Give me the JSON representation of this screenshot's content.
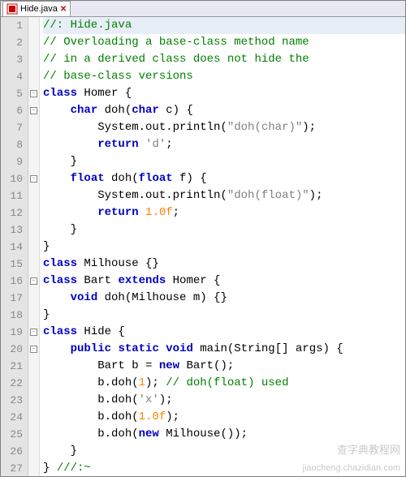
{
  "tab": {
    "filename": "Hide.java"
  },
  "code": {
    "lines": [
      {
        "n": 1,
        "fold": "",
        "seg": [
          [
            "c-comment",
            "//: Hide.java"
          ]
        ],
        "hl": true
      },
      {
        "n": 2,
        "fold": "",
        "seg": [
          [
            "c-comment",
            "// Overloading a base-class method name"
          ]
        ]
      },
      {
        "n": 3,
        "fold": "",
        "seg": [
          [
            "c-comment",
            "// in a derived class does not hide the"
          ]
        ]
      },
      {
        "n": 4,
        "fold": "",
        "seg": [
          [
            "c-comment",
            "// base-class versions"
          ]
        ]
      },
      {
        "n": 5,
        "fold": "box",
        "seg": [
          [
            "c-kw",
            "class"
          ],
          [
            "",
            " "
          ],
          [
            "c-id",
            "Homer"
          ],
          [
            "",
            " {"
          ]
        ]
      },
      {
        "n": 6,
        "fold": "box",
        "seg": [
          [
            "",
            "    "
          ],
          [
            "c-type",
            "char"
          ],
          [
            "",
            " doh("
          ],
          [
            "c-type",
            "char"
          ],
          [
            "",
            " c) {"
          ]
        ]
      },
      {
        "n": 7,
        "fold": "",
        "seg": [
          [
            "",
            "        System.out.println("
          ],
          [
            "c-str",
            "\"doh(char)\""
          ],
          [
            "",
            ");"
          ]
        ]
      },
      {
        "n": 8,
        "fold": "",
        "seg": [
          [
            "",
            "        "
          ],
          [
            "c-kw",
            "return"
          ],
          [
            "",
            " "
          ],
          [
            "c-char",
            "'d'"
          ],
          [
            "",
            ";"
          ]
        ]
      },
      {
        "n": 9,
        "fold": "",
        "seg": [
          [
            "",
            "    }"
          ]
        ]
      },
      {
        "n": 10,
        "fold": "box",
        "seg": [
          [
            "",
            "    "
          ],
          [
            "c-type",
            "float"
          ],
          [
            "",
            " doh("
          ],
          [
            "c-type",
            "float"
          ],
          [
            "",
            " f) {"
          ]
        ]
      },
      {
        "n": 11,
        "fold": "",
        "seg": [
          [
            "",
            "        System.out.println("
          ],
          [
            "c-str",
            "\"doh(float)\""
          ],
          [
            "",
            ");"
          ]
        ]
      },
      {
        "n": 12,
        "fold": "",
        "seg": [
          [
            "",
            "        "
          ],
          [
            "c-kw",
            "return"
          ],
          [
            "",
            " "
          ],
          [
            "c-num",
            "1.0f"
          ],
          [
            "",
            ";"
          ]
        ]
      },
      {
        "n": 13,
        "fold": "",
        "seg": [
          [
            "",
            "    }"
          ]
        ]
      },
      {
        "n": 14,
        "fold": "",
        "seg": [
          [
            "",
            "}"
          ]
        ]
      },
      {
        "n": 15,
        "fold": "",
        "seg": [
          [
            "c-kw",
            "class"
          ],
          [
            "",
            " Milhouse {}"
          ]
        ]
      },
      {
        "n": 16,
        "fold": "box",
        "seg": [
          [
            "c-kw",
            "class"
          ],
          [
            "",
            " Bart "
          ],
          [
            "c-kw",
            "extends"
          ],
          [
            "",
            " Homer {"
          ]
        ]
      },
      {
        "n": 17,
        "fold": "",
        "seg": [
          [
            "",
            "    "
          ],
          [
            "c-type",
            "void"
          ],
          [
            "",
            " doh(Milhouse m) {}"
          ]
        ]
      },
      {
        "n": 18,
        "fold": "",
        "seg": [
          [
            "",
            "}"
          ]
        ]
      },
      {
        "n": 19,
        "fold": "box",
        "seg": [
          [
            "c-kw",
            "class"
          ],
          [
            "",
            " Hide {"
          ]
        ]
      },
      {
        "n": 20,
        "fold": "box",
        "seg": [
          [
            "",
            "    "
          ],
          [
            "c-kw",
            "public"
          ],
          [
            "",
            " "
          ],
          [
            "c-kw",
            "static"
          ],
          [
            "",
            " "
          ],
          [
            "c-type",
            "void"
          ],
          [
            "",
            " main(String[] args) {"
          ]
        ]
      },
      {
        "n": 21,
        "fold": "",
        "seg": [
          [
            "",
            "        Bart b = "
          ],
          [
            "c-kw",
            "new"
          ],
          [
            "",
            " Bart();"
          ]
        ]
      },
      {
        "n": 22,
        "fold": "",
        "seg": [
          [
            "",
            "        b.doh("
          ],
          [
            "c-num",
            "1"
          ],
          [
            "",
            "); "
          ],
          [
            "c-comment",
            "// doh(float) used"
          ]
        ]
      },
      {
        "n": 23,
        "fold": "",
        "seg": [
          [
            "",
            "        b.doh("
          ],
          [
            "c-char",
            "'x'"
          ],
          [
            "",
            ");"
          ]
        ]
      },
      {
        "n": 24,
        "fold": "",
        "seg": [
          [
            "",
            "        b.doh("
          ],
          [
            "c-num",
            "1.0f"
          ],
          [
            "",
            ");"
          ]
        ]
      },
      {
        "n": 25,
        "fold": "",
        "seg": [
          [
            "",
            "        b.doh("
          ],
          [
            "c-kw",
            "new"
          ],
          [
            "",
            " Milhouse());"
          ]
        ]
      },
      {
        "n": 26,
        "fold": "",
        "seg": [
          [
            "",
            "    }"
          ]
        ]
      },
      {
        "n": 27,
        "fold": "",
        "seg": [
          [
            "",
            "} "
          ],
          [
            "c-comment",
            "///:~"
          ]
        ]
      }
    ]
  },
  "watermark": {
    "line1": "查字典教程网",
    "line2": "jiaocheng.chazidian.com"
  }
}
